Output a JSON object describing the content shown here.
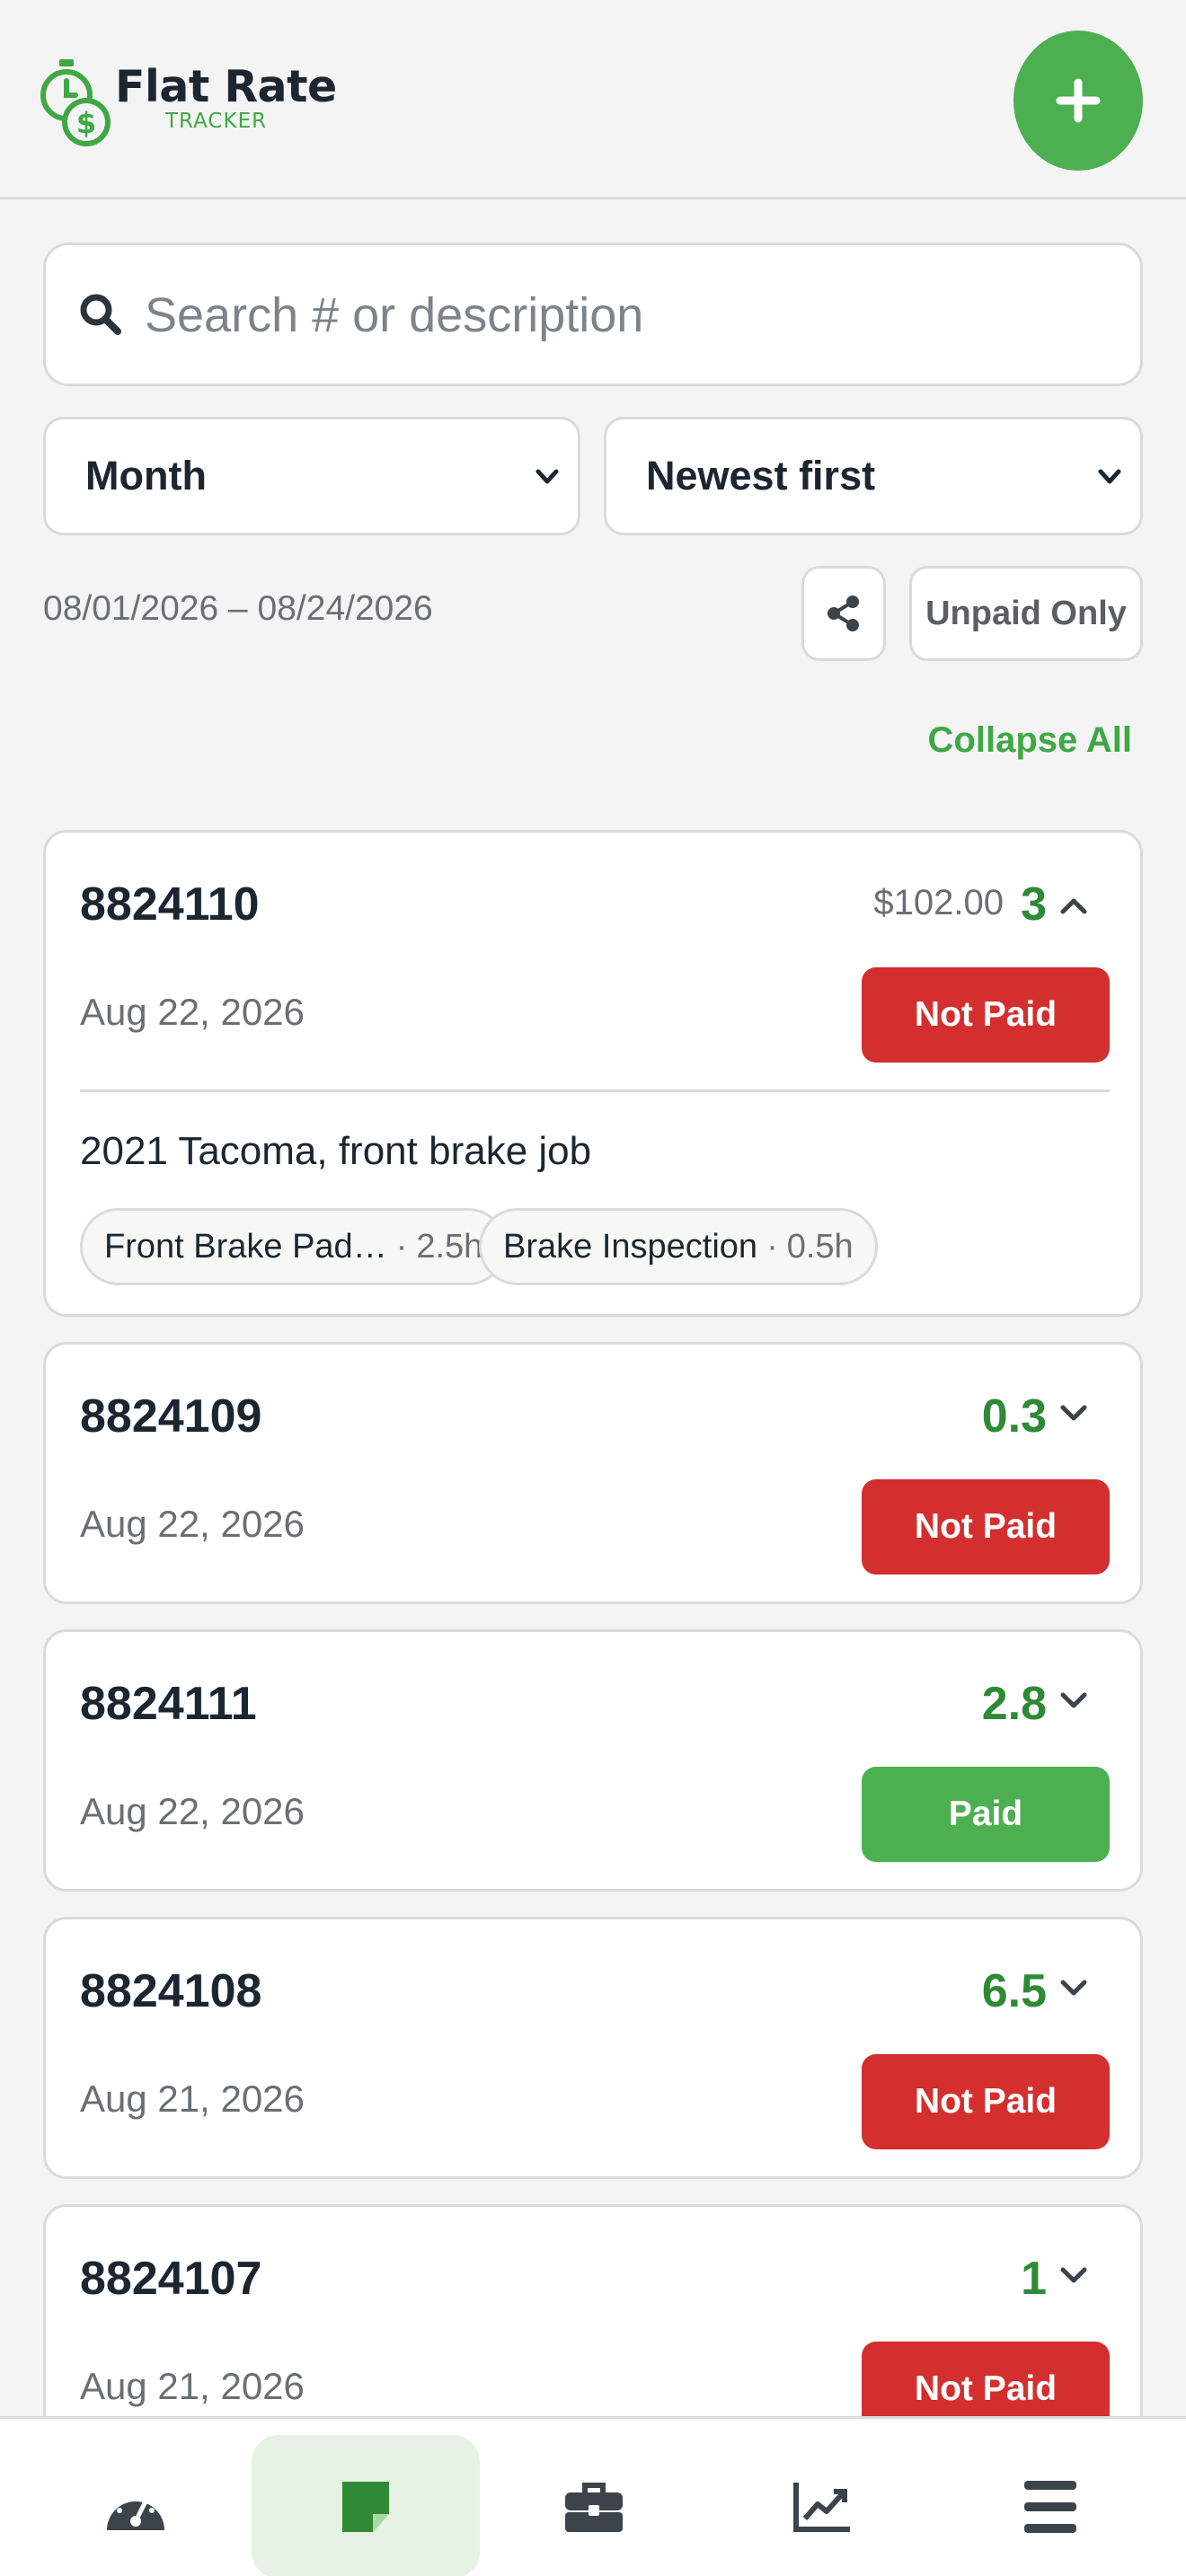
{
  "header": {
    "logo_title": "Flat Rate",
    "logo_subtitle": "TRACKER",
    "add_icon": "plus-icon"
  },
  "search": {
    "placeholder": "Search # or description",
    "value": ""
  },
  "filters": {
    "period": "Month",
    "sort": "Newest first",
    "date_range": "08/01/2026 – 08/24/2026",
    "unpaid_only_label": "Unpaid Only",
    "collapse_all_label": "Collapse All"
  },
  "colors": {
    "accent": "#4caf50",
    "hours": "#2f8a35",
    "not_paid": "#d32f2f"
  },
  "orders": [
    {
      "number": "8824110",
      "amount": "$102.00",
      "hours": "3",
      "date": "Aug 22, 2026",
      "status": "Not Paid",
      "expanded": true,
      "description": "2021 Tacoma, front brake job",
      "jobs": [
        {
          "name": "Front Brake Pad…",
          "hours": "2.5h"
        },
        {
          "name": "Brake Inspection",
          "hours": "0.5h"
        }
      ]
    },
    {
      "number": "8824109",
      "hours": "0.3",
      "date": "Aug 22, 2026",
      "status": "Not Paid",
      "expanded": false
    },
    {
      "number": "8824111",
      "hours": "2.8",
      "date": "Aug 22, 2026",
      "status": "Paid",
      "expanded": false
    },
    {
      "number": "8824108",
      "hours": "6.5",
      "date": "Aug 21, 2026",
      "status": "Not Paid",
      "expanded": false
    },
    {
      "number": "8824107",
      "hours": "1",
      "date": "Aug 21, 2026",
      "status": "Not Paid",
      "expanded": false
    }
  ],
  "bottom_nav": [
    {
      "icon": "dashboard-gauge-icon",
      "active": false
    },
    {
      "icon": "repair-orders-icon",
      "active": true
    },
    {
      "icon": "toolbox-icon",
      "active": false
    },
    {
      "icon": "chart-icon",
      "active": false
    },
    {
      "icon": "menu-icon",
      "active": false
    }
  ]
}
